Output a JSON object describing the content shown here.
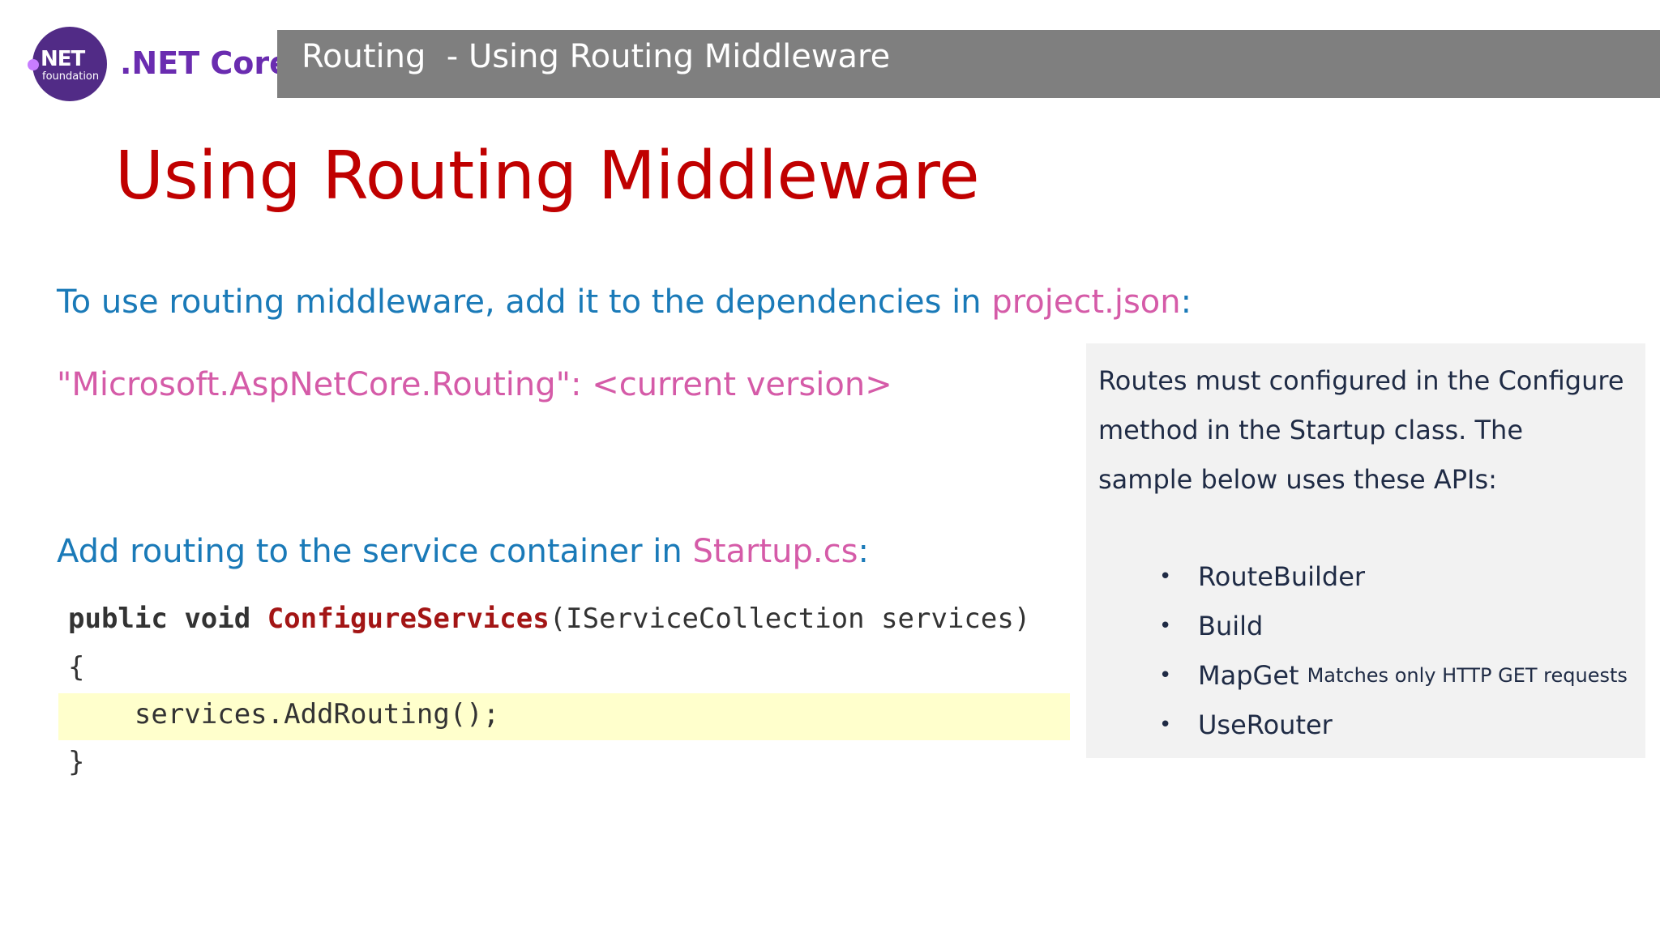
{
  "header": {
    "logo_net": "NET",
    "logo_foundation": "foundation",
    "brand": ".NET Core",
    "title": "Routing  - Using Routing Middleware"
  },
  "slide": {
    "title": "Using Routing Middleware",
    "intro_text": "To use routing middleware, add it to the dependencies in ",
    "intro_highlight": "project.json",
    "intro_end": ":",
    "dependency": "\"Microsoft.AspNetCore.Routing\": <current version>",
    "service_text": "Add routing to the service container in ",
    "service_highlight": "Startup.cs",
    "service_end": ":"
  },
  "code": {
    "kw_public": "public",
    "kw_void": "void",
    "method": "ConfigureServices",
    "params": "(IServiceCollection services)",
    "open_brace": "{",
    "body": "    services.AddRouting();",
    "close_brace": "}"
  },
  "side_panel": {
    "description": "Routes must configured in the Configure method in the Startup class. The sample below uses these APIs:",
    "bullet": "•",
    "apis": [
      {
        "name": "RouteBuilder",
        "note": ""
      },
      {
        "name": "Build",
        "note": ""
      },
      {
        "name": "MapGet",
        "note": "Matches only HTTP GET requests"
      },
      {
        "name": "UseRouter",
        "note": ""
      }
    ]
  },
  "colors": {
    "title_red": "#c00000",
    "body_blue": "#1a7ab8",
    "accent_pink": "#d55ba8",
    "header_gray": "#7f7f7f",
    "brand_purple": "#6a2cb0",
    "code_highlight": "#ffffcc"
  }
}
